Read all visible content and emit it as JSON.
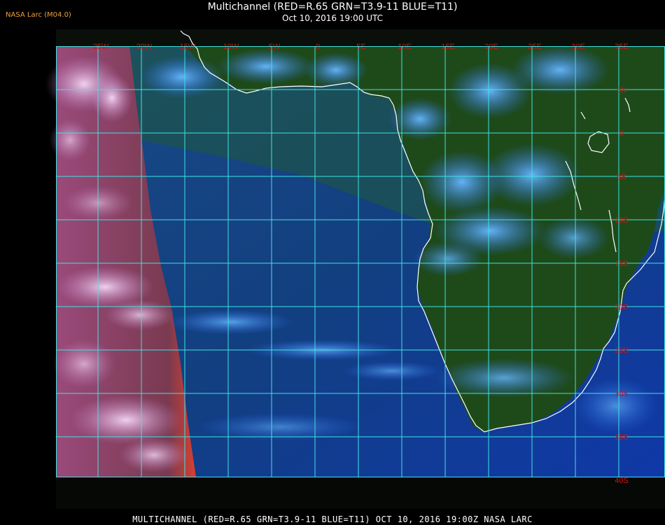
{
  "header": {
    "credit": "NASA Larc (M04.0)",
    "title": "Multichannel (RED=R.65 GRN=T3.9-11 BLUE=T11)",
    "subtitle": "Oct 10, 2016 19:00 UTC"
  },
  "footer": {
    "caption": "MULTICHANNEL (RED=R.65 GRN=T3.9-11 BLUE=T11) OCT 10, 2016 19:00Z   NASA LARC"
  },
  "map": {
    "grid_color": "#3fe3e3",
    "label_color": "#d81010",
    "coast_color": "#ffffff",
    "lon_labels": [
      "25W",
      "20W",
      "15W",
      "10W",
      "5W",
      "0",
      "5E",
      "10E",
      "15E",
      "20E",
      "25E",
      "30E",
      "35E"
    ],
    "lat_labels": [
      "5N",
      "0",
      "5S",
      "10S",
      "15S",
      "20S",
      "25S",
      "30S",
      "35S",
      "40S"
    ]
  }
}
